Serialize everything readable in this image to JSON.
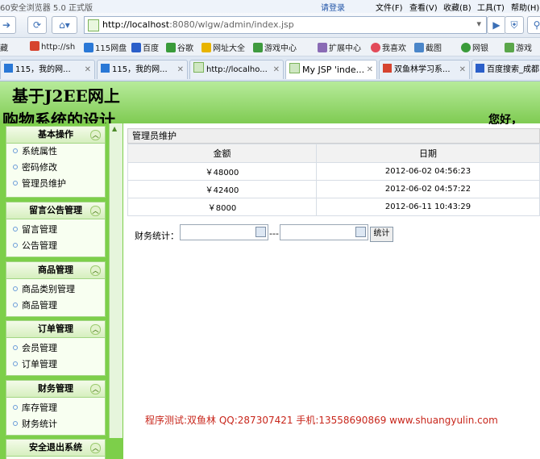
{
  "browser": {
    "title": "60安全浏览器 5.0 正式版",
    "menu": [
      "请登录",
      "文件(F)",
      "查看(V)",
      "收藏(B)",
      "工具(T)",
      "帮助(H)"
    ],
    "url_host": "http://localhost",
    "url_rest": ":8080/wlgw/admin/index.jsp",
    "bookmarks": [
      "藏",
      "http://sh",
      "115网盘",
      "百度",
      "谷歌",
      "网址大全",
      "游戏中心",
      "扩展中心",
      "我喜欢",
      "截图",
      "网银",
      "游戏"
    ],
    "tabs": [
      "115，我的网...",
      "115，我的网...",
      "http://localho...",
      "My JSP 'inde...",
      "双鱼林学习系...",
      "百度搜索_成都"
    ],
    "active_tab": 3
  },
  "banner": {
    "line1": "基于J2EE网上",
    "line2": "购物系统的设计",
    "greeting": "您好，"
  },
  "sidebar": {
    "sections": [
      {
        "title": "基本操作",
        "items": [
          "系统属性",
          "密码修改",
          "管理员维护"
        ]
      },
      {
        "title": "留言公告管理",
        "items": [
          "留言管理",
          "公告管理"
        ]
      },
      {
        "title": "商品管理",
        "items": [
          "商品类别管理",
          "商品管理"
        ]
      },
      {
        "title": "订单管理",
        "items": [
          "会员管理",
          "订单管理"
        ]
      },
      {
        "title": "财务管理",
        "items": [
          "库存管理",
          "财务统计"
        ]
      },
      {
        "title": "安全退出系统",
        "items": []
      }
    ]
  },
  "main": {
    "header": "管理员维护",
    "columns": [
      "金额",
      "日期"
    ],
    "rows": [
      [
        "￥48000",
        "2012-06-02 04:56:23"
      ],
      [
        "￥42400",
        "2012-06-02 04:57:22"
      ],
      [
        "￥8000",
        "2012-06-11 10:43:29"
      ]
    ],
    "stat_label": "财务统计：",
    "separator": "---",
    "stat_button": "统计"
  },
  "footer": "程序测试:双鱼林 QQ:287307421 手机:13558690869 www.shuangyulin.com"
}
